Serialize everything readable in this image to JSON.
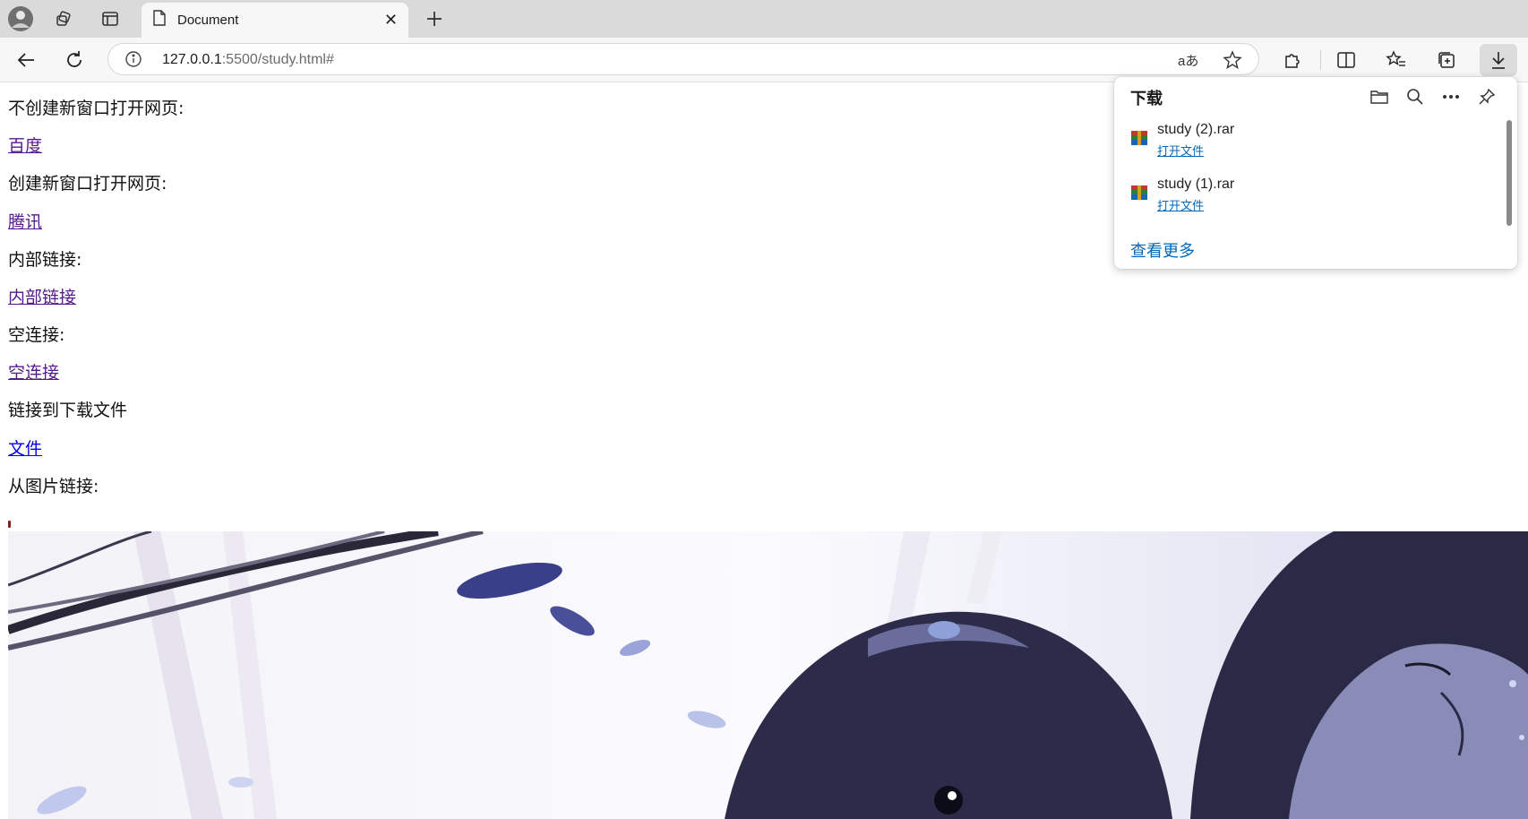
{
  "browser": {
    "tab_title": "Document",
    "url_host": "127.0.0.1",
    "url_rest": ":5500/study.html#",
    "icons": [
      "profile-avatar-icon",
      "workspaces-icon",
      "tab-actions-icon",
      "page-icon",
      "close-icon",
      "new-tab-icon",
      "back-icon",
      "refresh-icon",
      "info-icon",
      "read-aloud-icon",
      "favorite-star-icon",
      "extensions-icon",
      "split-screen-icon",
      "favorites-icon",
      "collections-icon",
      "download-icon"
    ]
  },
  "page": {
    "label1": "不创建新窗口打开网页:",
    "link1": "百度",
    "label2": "创建新窗口打开网页:",
    "link2": "腾讯",
    "label3": "内部链接:",
    "link3": "内部链接",
    "label4": "空连接:",
    "link4": "空连接",
    "label5": "链接到下载文件",
    "link5": "文件",
    "label6": "从图片链接:"
  },
  "downloads": {
    "title": "下载",
    "items": [
      {
        "name": "study (2).rar",
        "action": "打开文件"
      },
      {
        "name": "study (1).rar",
        "action": "打开文件"
      }
    ],
    "see_more": "查看更多"
  },
  "colors": {
    "visited_link": "#551a8b",
    "unvisited_link": "#0000ee",
    "accent": "#0067b8"
  }
}
